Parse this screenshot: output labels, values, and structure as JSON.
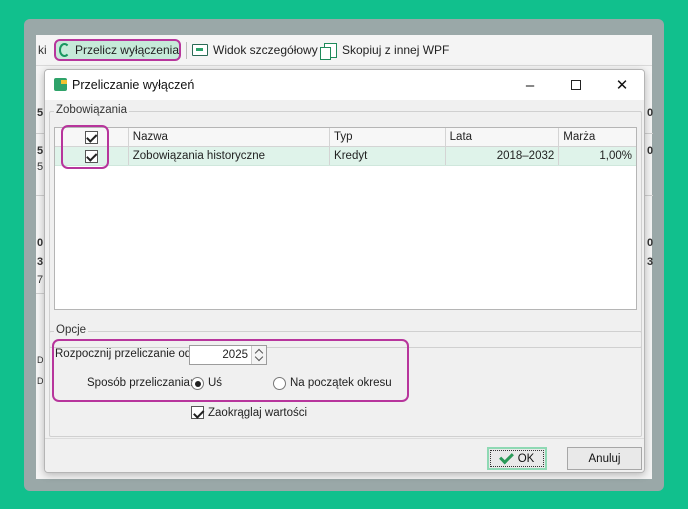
{
  "toolbar": {
    "clipped_label": "ki",
    "recalc_label": "Przelicz wyłączenia",
    "detail_label": "Widok szczegółowy",
    "copy_label": "Skopiuj z innej WPF",
    "icons": [
      "recalculate-icon",
      "detail-view-icon",
      "copy-icon"
    ]
  },
  "background": {
    "left_fragments": [
      "5",
      "5",
      "5",
      "0",
      "3",
      "7",
      "D",
      "D"
    ],
    "right_fragments": [
      "0",
      "0",
      "0",
      "3"
    ]
  },
  "dialog": {
    "title": "Przeliczanie wyłączeń",
    "window_controls": {
      "minimize": "–",
      "maximize": "□",
      "close": "✕"
    },
    "obligations_group": {
      "legend": "Zobowiązania",
      "columns": [
        "",
        "Nazwa",
        "Typ",
        "Lata",
        "Marża"
      ],
      "rows": [
        {
          "checked": true,
          "name": "Zobowiązania historyczne",
          "type": "Kredyt",
          "years": "2018–2032",
          "margin": "1,00%"
        }
      ],
      "header_checked": true
    },
    "options_group": {
      "legend": "Opcje",
      "start_label": "Rozpocznij przeliczanie od:",
      "start_value": "2025",
      "method_label": "Sposób przeliczania:",
      "method_options": [
        {
          "label": "Uś",
          "selected": true
        },
        {
          "label": "Na początek okresu",
          "selected": false
        }
      ],
      "round_label": "Zaokrąglaj wartości",
      "round_checked": true
    },
    "buttons": {
      "ok": "OK",
      "cancel": "Anuluj"
    }
  },
  "colors": {
    "background": "#11c08d",
    "highlight": "#b7359c",
    "row_selected": "#dff3ea",
    "accent": "#2fa36a"
  }
}
